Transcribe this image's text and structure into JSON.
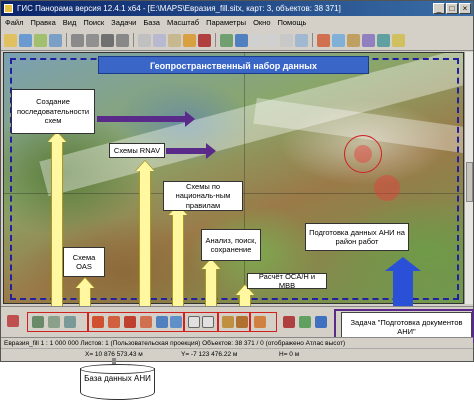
{
  "window": {
    "title": "ГИС Панорама версия 12.4.1 x64 - [E:\\MAPS\\Евразия_fill.sitx, карт: 3, объектов: 38 371]",
    "controls": [
      "_",
      "□",
      "×"
    ]
  },
  "menu": [
    "Файл",
    "Правка",
    "Вид",
    "Поиск",
    "Задачи",
    "База",
    "Масштаб",
    "Параметры",
    "Окно",
    "Помощь"
  ],
  "map": {
    "title": "Геопространственный  набор данных"
  },
  "callouts": {
    "sequence": "Создание последовательности схем",
    "rnav": "Схемы RNAV",
    "national": "Схемы по националь-ным правилам",
    "analysis": "Анализ, поиск, сохранение",
    "oas": "Схема OAS",
    "oca": "Расчёт OCA/H и МВВ",
    "ani_prep": "Подготовка данных АНИ на район работ",
    "task": "Задача \"Подготовка документов АНИ\""
  },
  "status": {
    "line1": "Евразия_fill   1 : 1 000 000   Листов: 1   (Пользовательская проекция)   Объектов: 38 371 / 0 (отображено Атлас высот)",
    "x": "X= 10 876 573.43 м",
    "y": "Y= -7 123 476.22 м",
    "h": "H= 0 м"
  },
  "database": {
    "label": "База данных АНИ"
  },
  "colors": {
    "title_blue": "#3a66c8",
    "arrow_yellow": "#fff8a0",
    "arrow_purple": "#5a2a8a",
    "arrow_blue": "#2a50d8",
    "group_red": "#d02020"
  }
}
